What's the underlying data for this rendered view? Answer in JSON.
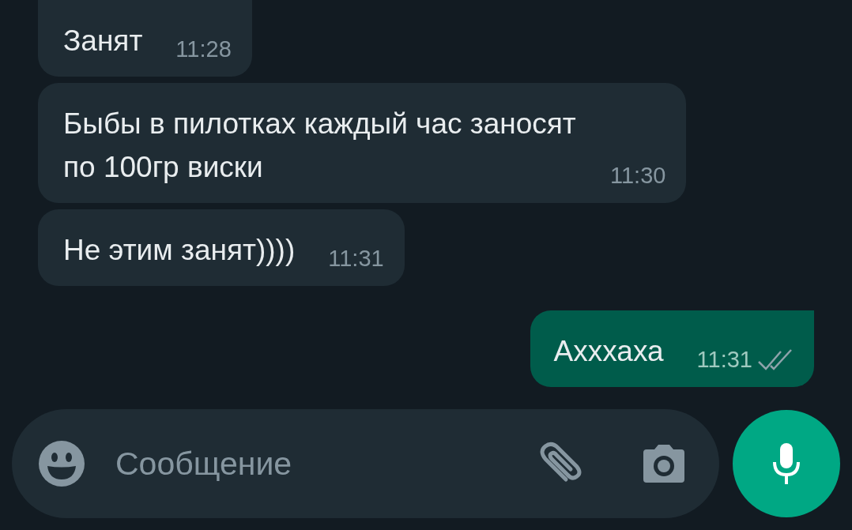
{
  "messages": [
    {
      "kind": "incoming",
      "text": "Занят",
      "time": "11:28"
    },
    {
      "kind": "incoming",
      "text": "Быбы в пилотках каждый час заносят по 100гр виски",
      "time": "11:30"
    },
    {
      "kind": "incoming",
      "text": "Не этим занят))))",
      "time": "11:31"
    },
    {
      "kind": "outgoing",
      "text": "Ахххаха",
      "time": "11:31",
      "read": false
    }
  ],
  "composer": {
    "placeholder": "Сообщение"
  }
}
